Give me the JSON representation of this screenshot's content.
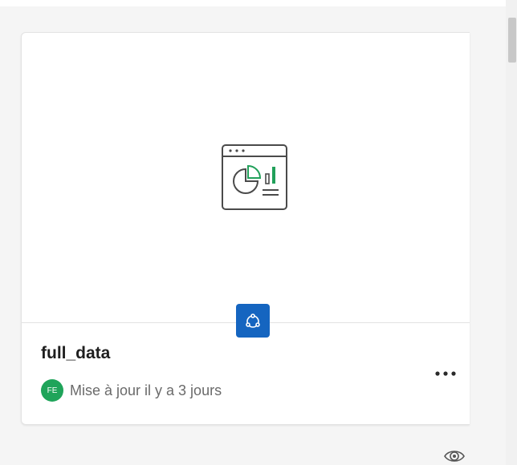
{
  "card": {
    "title": "full_data",
    "owner_initials": "FE",
    "updated_text": "Mise à jour il y a 3 jours"
  },
  "icons": {
    "app": "dashboard-chart-icon",
    "badge": "qlik-app-icon",
    "more": "more-options-icon",
    "visibility": "eye-icon"
  },
  "colors": {
    "badge": "#1565c0",
    "avatar": "#1fa45a",
    "chart_accent": "#21a05a"
  },
  "scrollbar": {
    "position": 0
  }
}
